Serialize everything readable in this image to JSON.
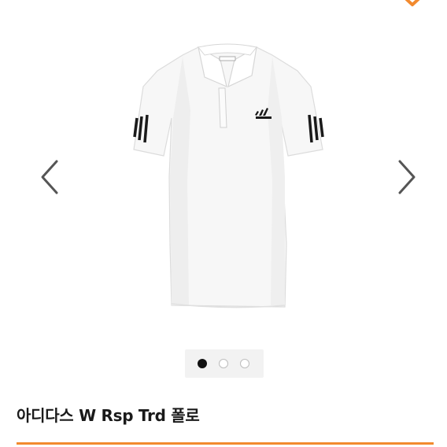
{
  "product": {
    "title": "아디다스 W Rsp Trd 폴로",
    "brand_logo_text": "adidas"
  },
  "carousel": {
    "image_count": 3,
    "active_index": 0,
    "prev_icon": "chevron-left-icon",
    "next_icon": "chevron-right-icon"
  },
  "colors": {
    "accent": "#f28a2e",
    "arrow": "#555555",
    "active_dot": "#111111",
    "inactive_dot_border": "#bdbdbd"
  }
}
